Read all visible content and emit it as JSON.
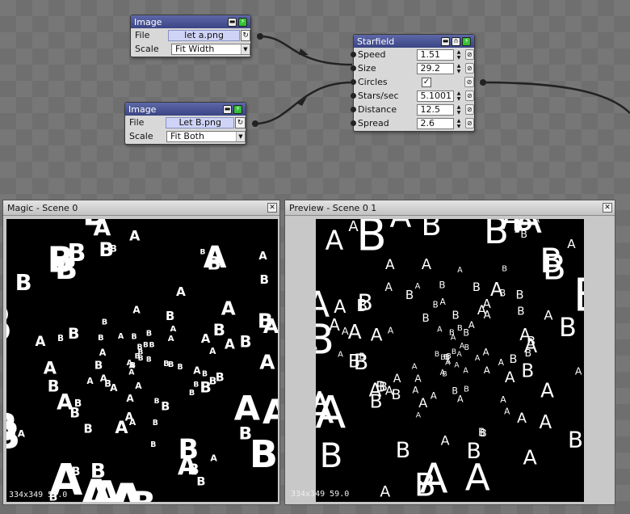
{
  "nodes": {
    "image_a": {
      "title": "Image",
      "file_label": "File",
      "file_value": "let a.png",
      "scale_label": "Scale",
      "scale_value": "Fit Width"
    },
    "image_b": {
      "title": "Image",
      "file_label": "File",
      "file_value": "Let B.png",
      "scale_label": "Scale",
      "scale_value": "Fit Both"
    },
    "starfield": {
      "title": "Starfield",
      "params": [
        {
          "label": "Speed",
          "value": "1.51"
        },
        {
          "label": "Size",
          "value": "29.2"
        },
        {
          "label": "Circles",
          "value": "✓"
        },
        {
          "label": "Stars/sec",
          "value": "5.1001"
        },
        {
          "label": "Distance",
          "value": "12.5"
        },
        {
          "label": "Spread",
          "value": "2.6"
        }
      ]
    }
  },
  "panels": {
    "magic": {
      "title": "Magic - Scene 0",
      "status": "334x349 59.0",
      "glyph_colors": [
        "#ffffff"
      ]
    },
    "preview": {
      "title": "Preview - Scene 0 1",
      "status": "334x349 59.0",
      "glyph_colors": [
        "#ffffff"
      ]
    }
  },
  "icons": {
    "minimize": "minimize-icon",
    "power": "power-icon",
    "refresh": "refresh-icon",
    "link": "link-icon",
    "close": "close-icon"
  },
  "colors": {
    "header": "#3b4585",
    "power_green": "#33c233",
    "file_field": "#cfd4f6",
    "canvas": "#000000"
  }
}
